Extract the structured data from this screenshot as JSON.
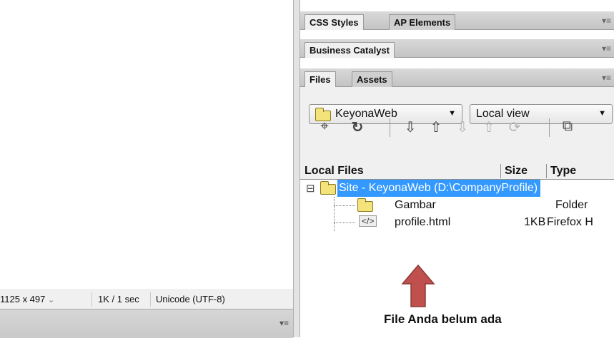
{
  "statusbar": {
    "dimensions": "1125 x 497",
    "dimensions_chevron": "⌄",
    "download": "1K / 1 sec",
    "encoding": "Unicode (UTF-8)"
  },
  "panels": {
    "group1": {
      "tabs": [
        "CSS Styles",
        "AP Elements"
      ],
      "menu": "▾≡"
    },
    "group2": {
      "tabs": [
        "Business Catalyst"
      ],
      "menu": "▾≡"
    },
    "group3": {
      "tabs": [
        "Files",
        "Assets"
      ],
      "menu": "▾≡"
    }
  },
  "files": {
    "site_select": "KeyonaWeb",
    "view_select": "Local view",
    "toolbar_icons": [
      "connect-icon",
      "refresh-icon",
      "get-files-icon",
      "put-files-icon",
      "check-out-icon",
      "check-in-icon",
      "synchronize-icon",
      "expand-icon"
    ],
    "columns": {
      "name": "Local Files",
      "size": "Size",
      "type": "Type"
    },
    "rows": [
      {
        "name": "Site - KeyonaWeb (D:\\CompanyProfile)",
        "size": "",
        "type": "",
        "toggle": "⊟"
      },
      {
        "name": "Gambar",
        "size": "",
        "type": "Folder"
      },
      {
        "name": "profile.html",
        "size": "1KB",
        "type": "Firefox H"
      }
    ]
  },
  "annotation": {
    "text": "File Anda belum ada",
    "arrow_color": "#c0504d"
  }
}
